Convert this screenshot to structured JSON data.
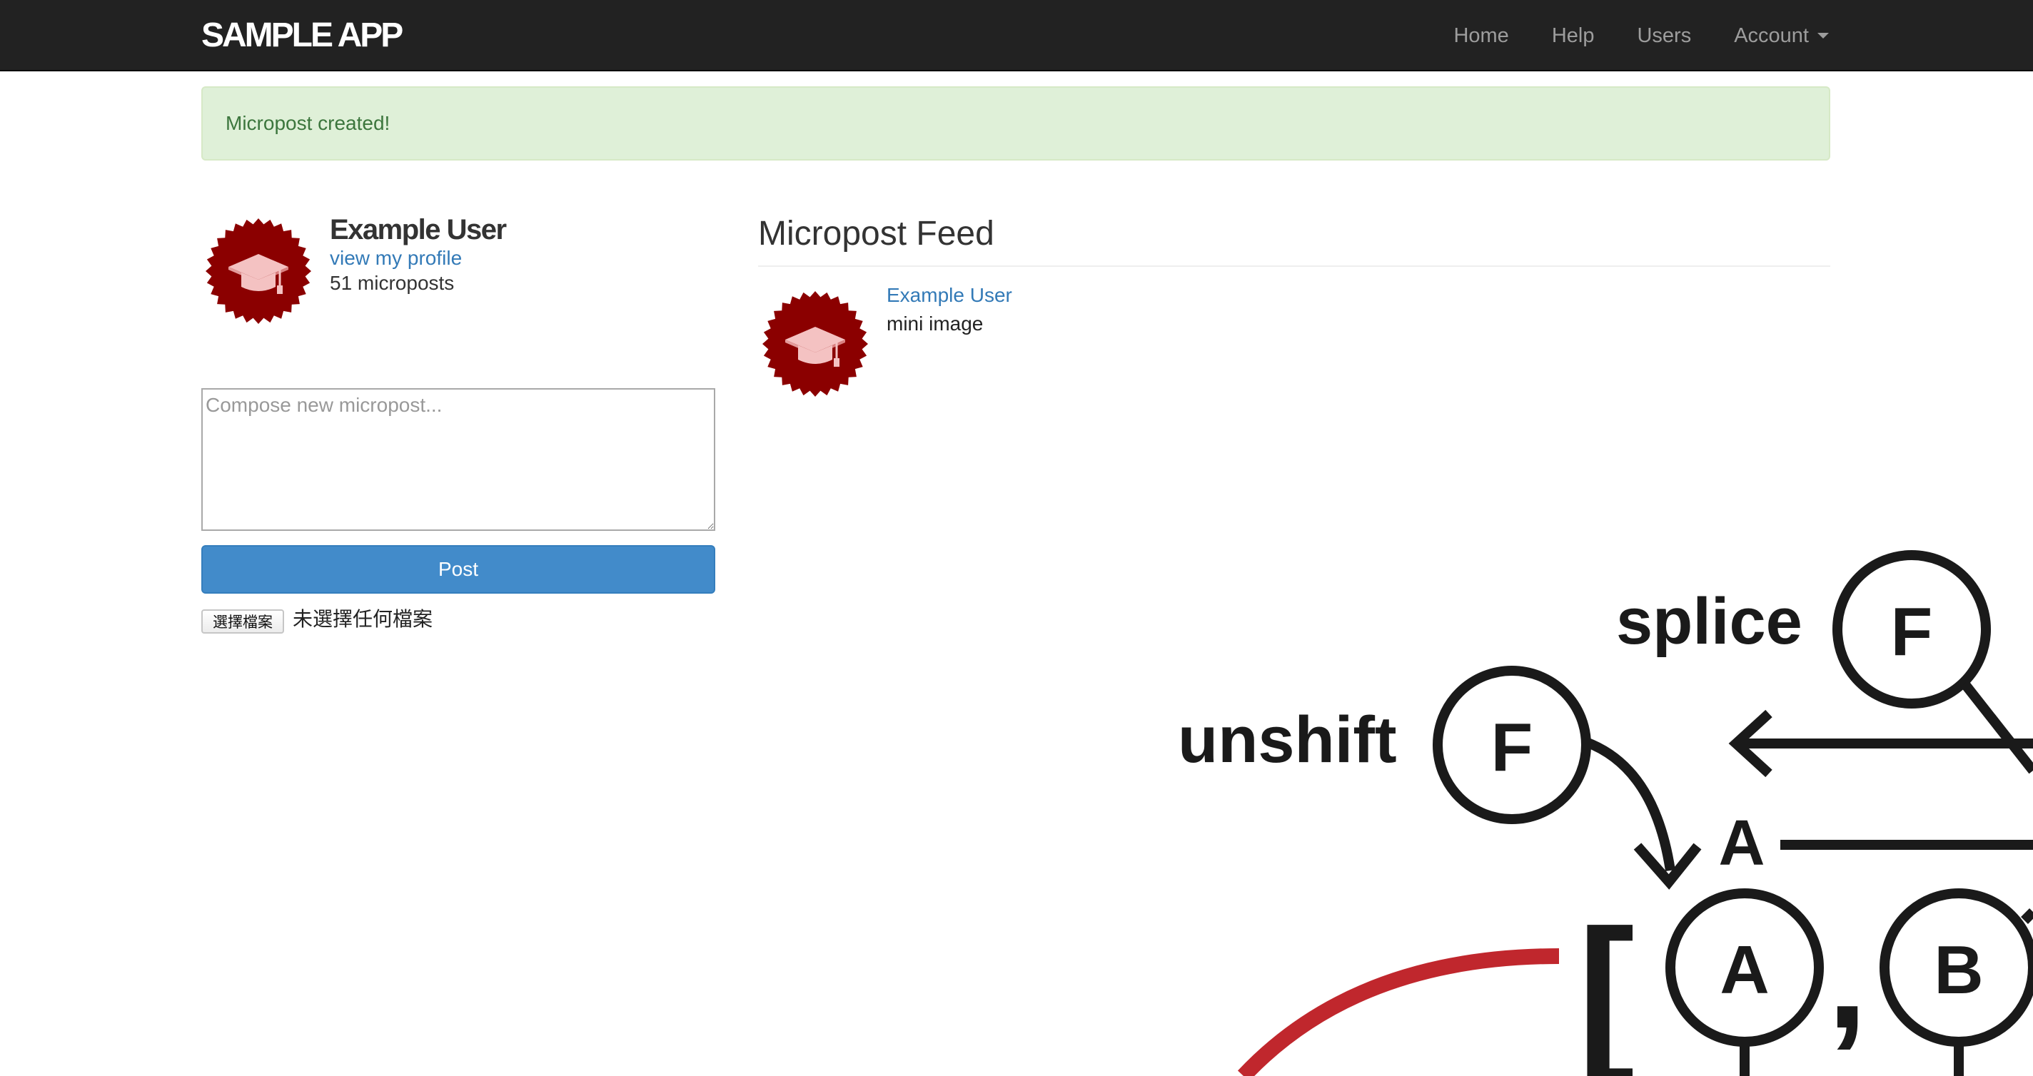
{
  "navbar": {
    "logo": "SAMPLE APP",
    "links": [
      {
        "label": "Home"
      },
      {
        "label": "Help"
      },
      {
        "label": "Users"
      },
      {
        "label": "Account"
      }
    ]
  },
  "alert": {
    "message": "Micropost created!"
  },
  "sidebar": {
    "user_name": "Example User",
    "profile_link": "view my profile",
    "micropost_count": "51 microposts",
    "avatar_icon": "graduation-cap-badge-icon"
  },
  "compose": {
    "placeholder": "Compose new micropost...",
    "value": "",
    "post_label": "Post",
    "file_button_label": "選擇檔案",
    "file_status": "未選擇任何檔案"
  },
  "feed": {
    "title": "Micropost Feed",
    "items": [
      {
        "user": "Example User",
        "content": "mini image",
        "image": {
          "labels": [
            "splice",
            "F",
            "unshift",
            "F",
            "A",
            "A",
            "B",
            "[",
            ","
          ]
        }
      }
    ]
  },
  "colors": {
    "navbar_bg": "#222222",
    "nav_link": "#9d9d9d",
    "alert_bg": "#dff0d8",
    "alert_text": "#3c763d",
    "link": "#337ab7",
    "primary_button": "#428bca",
    "avatar_red": "#8b0000",
    "diagram_red": "#c0272d"
  }
}
